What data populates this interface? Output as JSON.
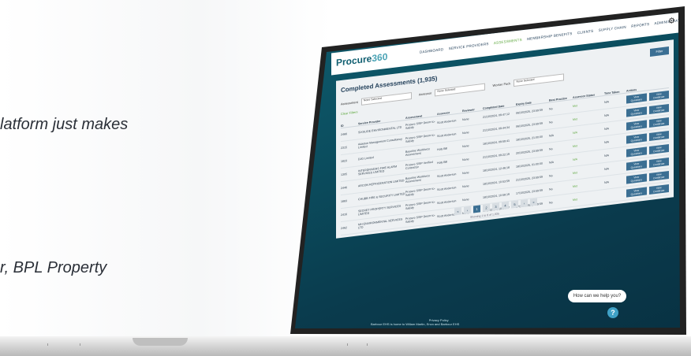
{
  "quote": {
    "line1": "latform just makes",
    "line2": "r, BPL Property"
  },
  "app": {
    "logo_main": "Procure",
    "logo_accent": "360",
    "nav": [
      "DASHBOARD",
      "SERVICE PROVIDERS",
      "ASSESSMENTS",
      "MEMBERSHIP BENEFITS",
      "CLIENTS",
      "SUPPLY CHAIN",
      "REPORTS",
      "ADMINISTRATION"
    ],
    "active_nav": "ASSESSMENTS",
    "page_title": "Completed Assessments (1,935)",
    "filter_label": "Filter",
    "filters": {
      "assessment_label": "Assessment",
      "assessment_value": "None Selected",
      "assessor_label": "Assessor",
      "assessor_value": "None Selected",
      "worker_pack_label": "Worker Pack",
      "worker_pack_value": "None Selected"
    },
    "clear_filters": "Clear Filters",
    "columns": [
      "ID",
      "Service Provider",
      "Assessment",
      "Assessor",
      "Reviewer",
      "Completed Date",
      "Expiry Date",
      "Best Practice",
      "Assessor Status",
      "Time Taken",
      "Actions"
    ],
    "rows": [
      {
        "id": "2466",
        "sp": "SIXSLIDE ENVIRONMENTAL LTD",
        "assessment": "Procure SSIP Deem-to-Satisfy",
        "assessor": "Scott Anderson",
        "reviewer": "None",
        "completed": "21/10/2024, 09:47:12",
        "expiry": "06/10/2025, 23:59:59",
        "bp": "No",
        "status": "Met",
        "time": "N/A"
      },
      {
        "id": "2315",
        "sp": "Adaston Management Consultancy Limited",
        "assessment": "Procure SSIP Deem-to-Satisfy",
        "assessor": "Scott Anderson",
        "reviewer": "None",
        "completed": "21/10/2024, 09:44:34",
        "expiry": "06/10/2025, 23:59:59",
        "bp": "No",
        "status": "Met",
        "time": "N/A"
      },
      {
        "id": "1823",
        "sp": "DJG Limited",
        "assessment": "Baseline Workforce Assessment",
        "assessor": "Holy Bill",
        "reviewer": "None",
        "completed": "18/10/2024, 09:59:41",
        "expiry": "18/10/2025, 21:00:00",
        "bp": "N/A",
        "status": "N/A",
        "time": "N/A"
      },
      {
        "id": "1305",
        "sp": "INTERDRIVERS FIRE ALARM SERVICES LIMITED",
        "assessment": "Procure SSIP Verified Contractor",
        "assessor": "Holy Bill",
        "reviewer": "None",
        "completed": "21/10/2024, 09:22:19",
        "expiry": "20/10/2025, 23:59:59",
        "bp": "No",
        "status": "Met",
        "time": "N/A"
      },
      {
        "id": "2446",
        "sp": "ARCON REFRIGERATION LIMITED",
        "assessment": "Baseline Workforce Assessment",
        "assessor": "Scott Anderson",
        "reviewer": "None",
        "completed": "18/10/2024, 12:46:18",
        "expiry": "18/10/2025, 01:00:00",
        "bp": "N/A",
        "status": "N/A",
        "time": "N/A"
      },
      {
        "id": "1883",
        "sp": "CHUBB FIRE & SECURITY LIMITED",
        "assessment": "Procure SSIP Deem-to-Satisfy",
        "assessor": "Scott Anderson",
        "reviewer": "None",
        "completed": "18/10/2024, 10:53:59",
        "expiry": "21/10/2025, 23:59:59",
        "bp": "No",
        "status": "Met",
        "time": "N/A"
      },
      {
        "id": "2416",
        "sp": "SECRET PROPERTY SERVICES LIMITED",
        "assessment": "Procure SSIP Deem-to-Satisfy",
        "assessor": "Scott Anderson",
        "reviewer": "None",
        "completed": "18/10/2024, 10:58:19",
        "expiry": "17/10/2025, 23:59:59",
        "bp": "No",
        "status": "Met",
        "time": "N/A"
      },
      {
        "id": "2462",
        "sp": "MH ENVIRONMENTAL SERVICES LTD",
        "assessment": "Procure SSIP Deem-to-Satisfy",
        "assessor": "Scott Anderson",
        "reviewer": "None",
        "completed": "18/10/2024, 10:55:47",
        "expiry": "17/10/2025, 23:59:59",
        "bp": "No",
        "status": "Met",
        "time": ""
      }
    ],
    "action_questions": "View Questions",
    "action_certificate": "View Certificate",
    "pages": [
      "«",
      "‹",
      "1",
      "2",
      "3",
      "4",
      "5",
      "›",
      "»"
    ],
    "current_page": "1",
    "showing": "Showing 1 to 8 of 1,935",
    "help_text": "How can we help you?",
    "help_icon": "?",
    "footer_line1": "Privacy Policy",
    "footer_line2": "Barbour EHS is home to Willam Martin, Envo and Barbour EHS"
  }
}
